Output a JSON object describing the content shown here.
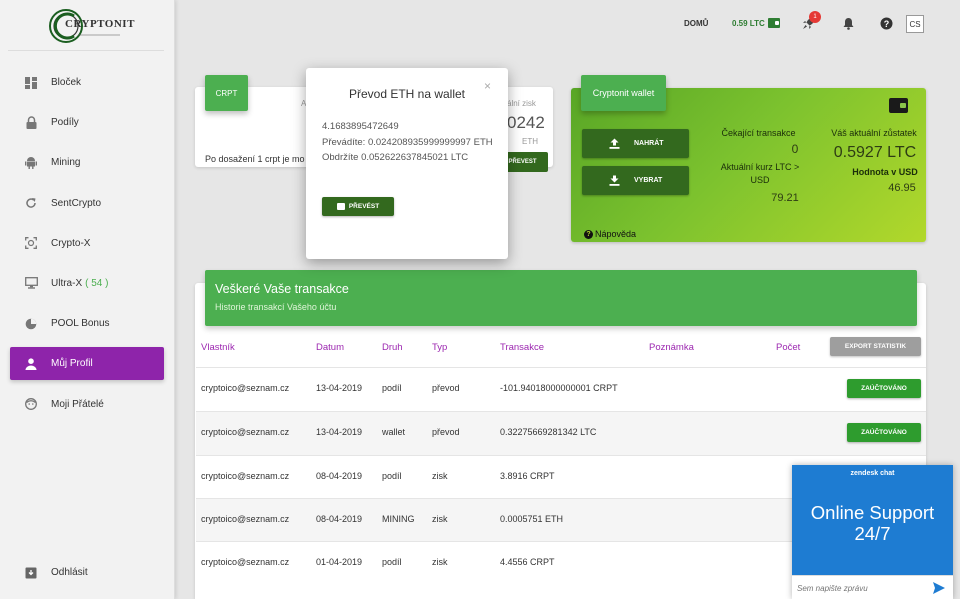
{
  "brand": {
    "logo_text": "CRYPTONIT"
  },
  "sidebar": {
    "items": [
      {
        "label": "Bloček",
        "icon": "dashboard-icon",
        "active": false
      },
      {
        "label": "Podíly",
        "icon": "lock-icon",
        "active": false
      },
      {
        "label": "Mining",
        "icon": "android-icon",
        "active": false
      },
      {
        "label": "SentCrypto",
        "icon": "refresh-icon",
        "active": false
      },
      {
        "label": "Crypto-X",
        "icon": "focus-icon",
        "active": false
      },
      {
        "label": "Ultra-X",
        "badge": "( 54 )",
        "icon": "monitor-icon",
        "active": false
      },
      {
        "label": "POOL Bonus",
        "icon": "pie-chart-icon",
        "active": false
      },
      {
        "label": "Můj Profil",
        "icon": "person-icon",
        "active": true
      },
      {
        "label": "Moji Přátelé",
        "icon": "face-icon",
        "active": false
      }
    ],
    "logout": "Odhlásit"
  },
  "topbar": {
    "home": "DOMŮ",
    "balance": "0.59 LTC",
    "notif_count": "1",
    "lang": "CS"
  },
  "crpt_card": {
    "header": "CRPT",
    "label_a": "A",
    "zisk_label": "ální zisk",
    "big_value": "0242",
    "unit": "ETH",
    "button": "PŘEVEST",
    "desc": "Po dosažení 1 crpt je mo"
  },
  "wallet": {
    "tab": "Cryptonit wallet",
    "upload": "NAHRÁT",
    "withdraw": "VYBRAT",
    "pending_label": "Čekající transakce",
    "pending_value": "0",
    "rate_label": "Aktuální kurz LTC > USD",
    "rate_value": "79.21",
    "balance_label": "Váš aktuální zůstatek",
    "balance_value": "0.5927 LTC",
    "usd_label": "Hodnota v USD",
    "usd_value": "46.95",
    "help": "Nápověda",
    "accent": "#7cc22e"
  },
  "transactions": {
    "title": "Veškeré Vaše transakce",
    "subtitle": "Historie transakcí Vašeho účtu",
    "export": "EXPORT STATISTIK",
    "columns": [
      "Vlastník",
      "Datum",
      "Druh",
      "Typ",
      "Transakce",
      "Poznámka",
      "Počet"
    ],
    "rows": [
      {
        "owner": "cryptoico@seznam.cz",
        "date": "13-04-2019",
        "kind": "podíl",
        "type": "převod",
        "amount": "-101.94018000000001 CRPT",
        "status": "ZAÚČTOVÁNO"
      },
      {
        "owner": "cryptoico@seznam.cz",
        "date": "13-04-2019",
        "kind": "wallet",
        "type": "převod",
        "amount": "0.32275669281342 LTC",
        "status": "ZAÚČTOVÁNO"
      },
      {
        "owner": "cryptoico@seznam.cz",
        "date": "08-04-2019",
        "kind": "podíl",
        "type": "zisk",
        "amount": "3.8916 CRPT",
        "status": ""
      },
      {
        "owner": "cryptoico@seznam.cz",
        "date": "08-04-2019",
        "kind": "MINING",
        "type": "zisk",
        "amount": "0.0005751 ETH",
        "status": ""
      },
      {
        "owner": "cryptoico@seznam.cz",
        "date": "01-04-2019",
        "kind": "podíl",
        "type": "zisk",
        "amount": "4.4556 CRPT",
        "status": ""
      }
    ]
  },
  "modal": {
    "title": "Převod ETH na wallet",
    "close": "×",
    "line1": "4.1683895472649",
    "line2": "Převádíte: 0.024208935999999997 ETH",
    "line3": "Obdržíte 0.052622637845021 LTC",
    "button": "PŘEVÉST"
  },
  "chat": {
    "brand": "zendesk chat",
    "title": "Online Support 24/7",
    "placeholder": "Sem napište zprávu"
  }
}
